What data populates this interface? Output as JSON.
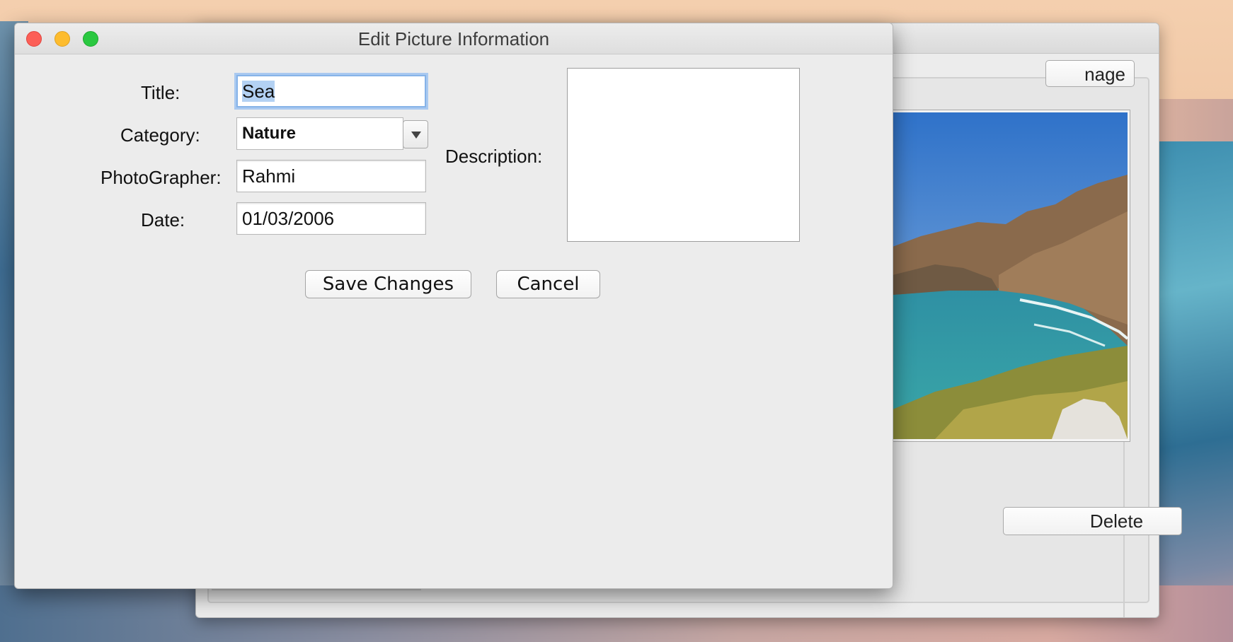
{
  "background_window": {
    "tab_label_partial": "nage",
    "delete_label": "Delete"
  },
  "dialog": {
    "title": "Edit Picture Information",
    "labels": {
      "title": "Title:",
      "category": "Category:",
      "photographer": "PhotoGrapher:",
      "date": "Date:",
      "description": "Description:"
    },
    "values": {
      "title": "Sea",
      "category": "Nature",
      "photographer": "Rahmi",
      "date": "01/03/2006",
      "description": ""
    },
    "buttons": {
      "save": "Save Changes",
      "cancel": "Cancel"
    }
  },
  "colors": {
    "selection": "#b3d1f3",
    "focus_ring": "#86b3e8",
    "close": "#fc5f57",
    "minimize": "#fdbc2e",
    "zoom": "#2ac840"
  }
}
